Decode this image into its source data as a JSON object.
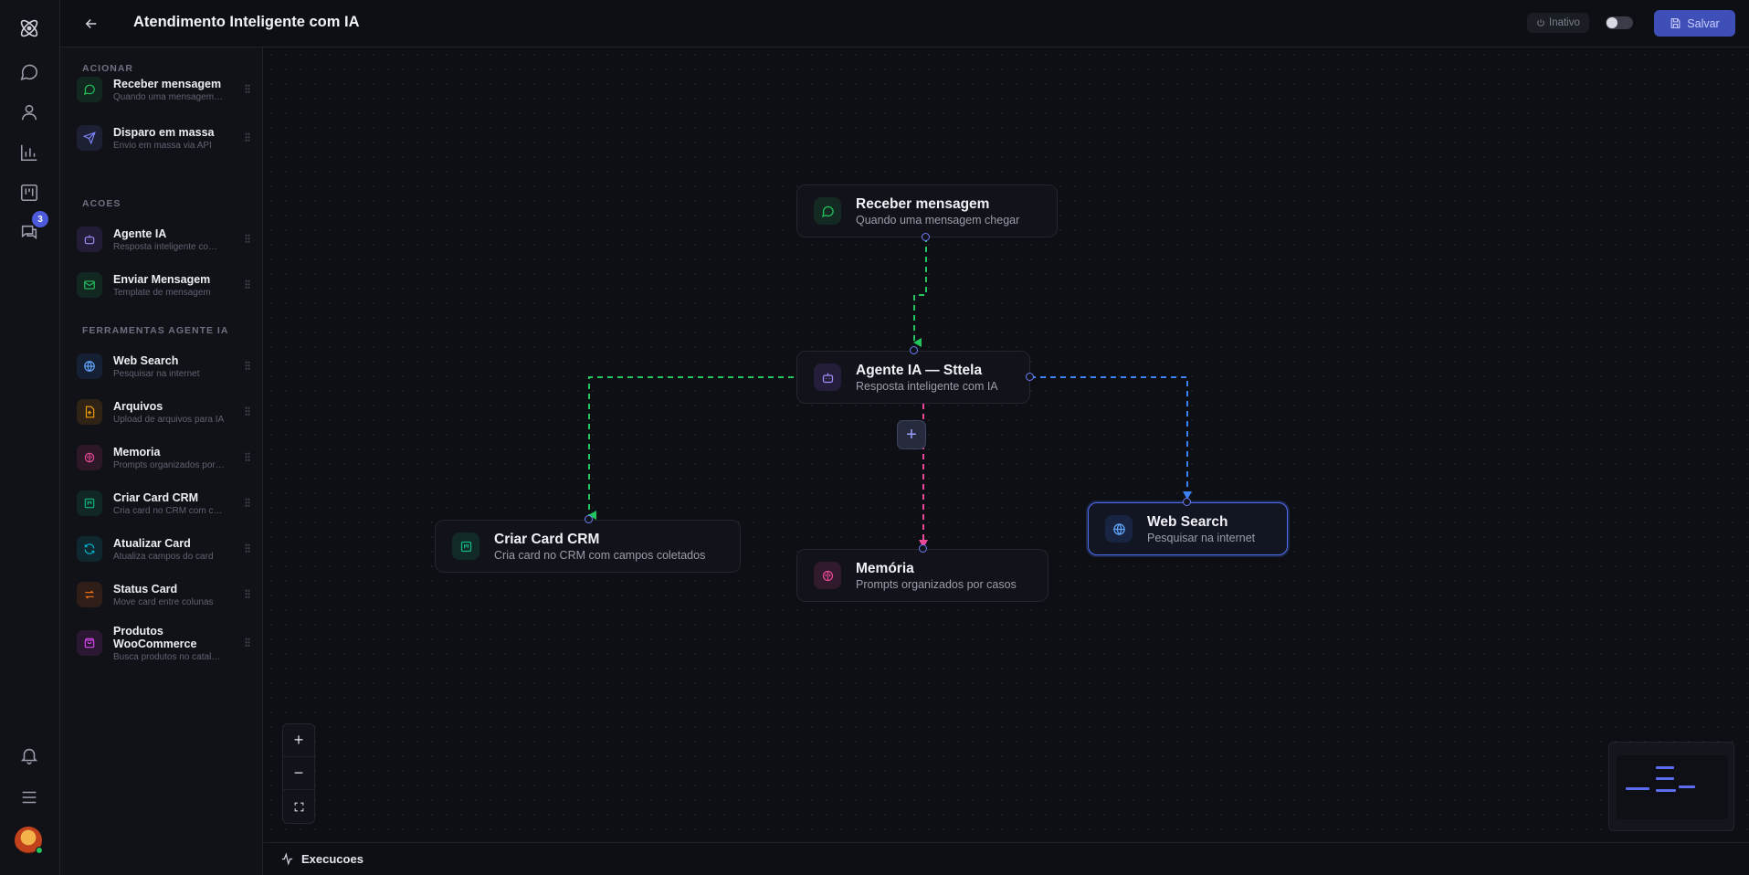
{
  "header": {
    "title": "Atendimento Inteligente com IA",
    "status": "Inativo",
    "save_label": "Salvar"
  },
  "rail": {
    "badge_count": "3"
  },
  "sidebar": {
    "sections": [
      {
        "title": "ACIONAR"
      },
      {
        "title": "ACOES"
      },
      {
        "title": "FERRAMENTAS AGENTE IA"
      }
    ],
    "items": [
      {
        "title": "Receber mensagem",
        "subtitle": "Quando uma mensagem chegar",
        "icon": "message-circle-icon",
        "color": "#22c55e"
      },
      {
        "title": "Disparo em massa",
        "subtitle": "Envio em massa via API",
        "icon": "send-icon",
        "color": "#7c83f7"
      },
      {
        "title": "Agente IA",
        "subtitle": "Resposta inteligente com IA",
        "icon": "bot-icon",
        "color": "#8b5cf6"
      },
      {
        "title": "Enviar Mensagem",
        "subtitle": "Template de mensagem",
        "icon": "mail-icon",
        "color": "#22c55e"
      },
      {
        "title": "Web Search",
        "subtitle": "Pesquisar na internet",
        "icon": "globe-icon",
        "color": "#3b82f6"
      },
      {
        "title": "Arquivos",
        "subtitle": "Upload de arquivos para IA",
        "icon": "file-upload-icon",
        "color": "#f59e0b"
      },
      {
        "title": "Memoria",
        "subtitle": "Prompts organizados por casos",
        "icon": "brain-icon",
        "color": "#ec4899"
      },
      {
        "title": "Criar Card CRM",
        "subtitle": "Cria card no CRM com campos",
        "icon": "kanban-icon",
        "color": "#10b981"
      },
      {
        "title": "Atualizar Card",
        "subtitle": "Atualiza campos do card",
        "icon": "refresh-icon",
        "color": "#06b6d4"
      },
      {
        "title": "Status Card",
        "subtitle": "Move card entre colunas",
        "icon": "swap-icon",
        "color": "#f97316"
      },
      {
        "title": "Produtos WooCommerce",
        "subtitle": "Busca produtos no catalogo",
        "icon": "shopping-bag-icon",
        "color": "#d946ef"
      }
    ]
  },
  "canvas": {
    "nodes": [
      {
        "id": "trigger",
        "title": "Receber mensagem",
        "subtitle": "Quando uma mensagem chegar",
        "icon": "message-circle-icon",
        "color": "#22c55e"
      },
      {
        "id": "agent",
        "title": "Agente IA — Sttela",
        "subtitle": "Resposta inteligente com IA",
        "icon": "bot-icon",
        "color": "#8b5cf6"
      },
      {
        "id": "crm",
        "title": "Criar Card CRM",
        "subtitle": "Cria card no CRM com campos coletados",
        "icon": "kanban-icon",
        "color": "#10b981"
      },
      {
        "id": "memory",
        "title": "Memória",
        "subtitle": "Prompts organizados por casos",
        "icon": "brain-icon",
        "color": "#ec4899"
      },
      {
        "id": "search",
        "title": "Web Search",
        "subtitle": "Pesquisar na internet",
        "icon": "globe-icon",
        "color": "#3b82f6"
      }
    ],
    "edge_colors": {
      "trigger_agent": "#22c55e",
      "agent_crm": "#22c55e",
      "agent_memory": "#ec4899",
      "agent_search": "#3b82f6"
    },
    "selected_node": "search"
  },
  "footer": {
    "label": "Execucoes"
  },
  "colors": {
    "accent": "#4d5fd6",
    "handle": "#6e7cf5"
  }
}
